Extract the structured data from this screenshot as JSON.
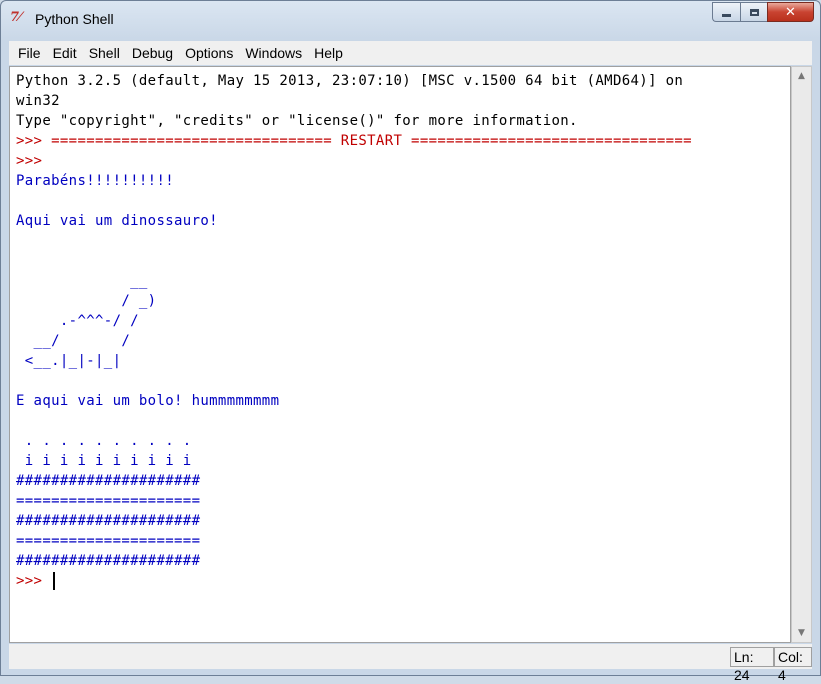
{
  "window": {
    "title": "Python Shell",
    "icon": "python-idle-icon",
    "icon_glyph": "7⁄",
    "controls": {
      "minimize": "minimize-icon",
      "maximize": "maximize-icon",
      "close": "close-icon",
      "close_glyph": "✕"
    }
  },
  "menubar": {
    "items": [
      {
        "label": "File"
      },
      {
        "label": "Edit"
      },
      {
        "label": "Shell"
      },
      {
        "label": "Debug"
      },
      {
        "label": "Options"
      },
      {
        "label": "Windows"
      },
      {
        "label": "Help"
      }
    ]
  },
  "shell": {
    "lines": [
      {
        "kind": "plain",
        "text": "Python 3.2.5 (default, May 15 2013, 23:07:10) [MSC v.1500 64 bit (AMD64)] on"
      },
      {
        "kind": "plain",
        "text": "win32"
      },
      {
        "kind": "plain",
        "text": "Type \"copyright\", \"credits\" or \"license()\" for more information."
      },
      {
        "kind": "prompt",
        "text": ">>> ================================ RESTART ================================"
      },
      {
        "kind": "prompt",
        "text": ">>>"
      },
      {
        "kind": "out",
        "text": "Parabéns!!!!!!!!!!"
      },
      {
        "kind": "out",
        "text": ""
      },
      {
        "kind": "out",
        "text": "Aqui vai um dinossauro!"
      },
      {
        "kind": "out",
        "text": ""
      },
      {
        "kind": "out",
        "text": ""
      },
      {
        "kind": "out",
        "text": "             __"
      },
      {
        "kind": "out",
        "text": "            / _)"
      },
      {
        "kind": "out",
        "text": "     .-^^^-/ /"
      },
      {
        "kind": "out",
        "text": "  __/       /"
      },
      {
        "kind": "out",
        "text": " <__.|_|-|_|"
      },
      {
        "kind": "out",
        "text": ""
      },
      {
        "kind": "out",
        "text": "E aqui vai um bolo! hummmmmmmm"
      },
      {
        "kind": "out",
        "text": ""
      },
      {
        "kind": "out",
        "text": " . . . . . . . . . ."
      },
      {
        "kind": "out",
        "text": " i i i i i i i i i i"
      },
      {
        "kind": "out",
        "text": "#####################"
      },
      {
        "kind": "out",
        "text": "====================="
      },
      {
        "kind": "out",
        "text": "#####################"
      },
      {
        "kind": "out",
        "text": "====================="
      },
      {
        "kind": "out",
        "text": "#####################"
      }
    ],
    "last_prompt": ">>> "
  },
  "scrollbar": {
    "up": "scroll-up-arrow-icon",
    "down": "scroll-down-arrow-icon"
  },
  "status": {
    "line": "Ln: 24",
    "col": "Col: 4"
  }
}
